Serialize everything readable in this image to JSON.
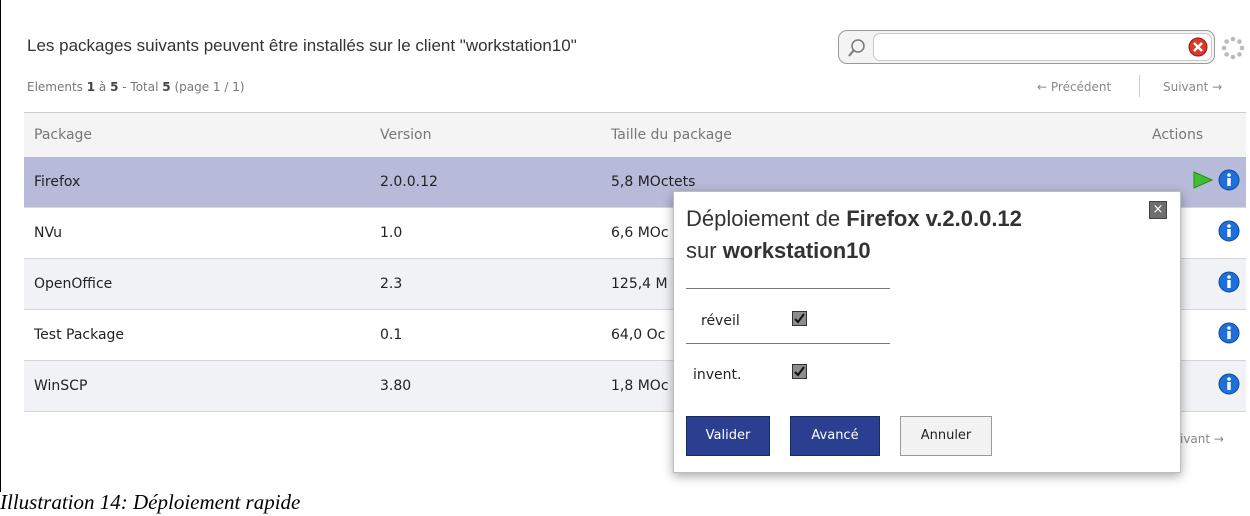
{
  "header": {
    "title": "Les packages suivants peuvent être installés sur le client \"workstation10\"",
    "counts_prefix": "Elements ",
    "counts_start": "1",
    "counts_mid": " à ",
    "counts_end": "5",
    "counts_total_label": " - Total ",
    "counts_total": "5",
    "counts_page": " (page 1 / 1)"
  },
  "search": {
    "value": "",
    "placeholder": ""
  },
  "pager": {
    "previous": "← Précédent",
    "next": "Suivant →",
    "bottom_next": "ivant →"
  },
  "table": {
    "columns": [
      "Package",
      "Version",
      "Taille du package",
      "Actions"
    ],
    "rows": [
      {
        "package": "Firefox",
        "version": "2.0.0.12",
        "size": "5,8 MOctets"
      },
      {
        "package": "NVu",
        "version": "1.0",
        "size": "6,6 MOc"
      },
      {
        "package": "OpenOffice",
        "version": "2.3",
        "size": "125,4 M"
      },
      {
        "package": "Test Package",
        "version": "0.1",
        "size": "64,0 Oc"
      },
      {
        "package": "WinSCP",
        "version": "3.80",
        "size": "1,8 MOc"
      }
    ]
  },
  "popup": {
    "title_prefix": "Déploiement de ",
    "title_package": "Firefox v.2.0.0.12",
    "title_on": "sur ",
    "title_host": "workstation10",
    "close_label": "×",
    "option_wake": "réveil",
    "option_inventory": "invent.",
    "wake_checked": true,
    "inventory_checked": true,
    "btn_validate": "Valider",
    "btn_advanced": "Avancé",
    "btn_cancel": "Annuler"
  },
  "caption": "Illustration 14: Déploiement rapide",
  "colors": {
    "selected_row": "#b7bbd9",
    "primary_button": "#2b3f91",
    "play_icon": "#3fbf2e",
    "info_icon": "#1e6fd9"
  },
  "icons": [
    "search-icon",
    "clear-icon",
    "spinner-icon",
    "play-icon",
    "info-icon",
    "close-icon",
    "check-icon"
  ]
}
